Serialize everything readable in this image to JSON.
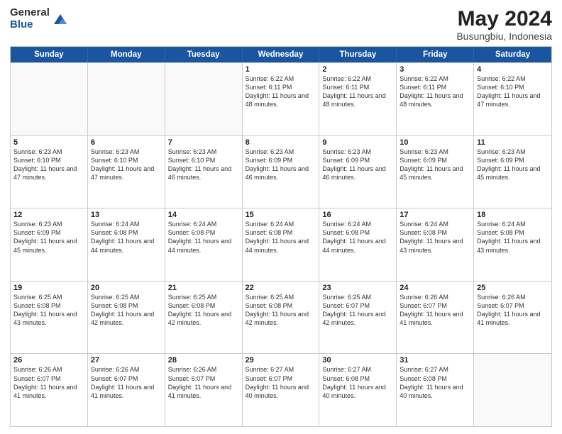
{
  "logo": {
    "general": "General",
    "blue": "Blue"
  },
  "title": "May 2024",
  "location": "Busungbiu, Indonesia",
  "days_of_week": [
    "Sunday",
    "Monday",
    "Tuesday",
    "Wednesday",
    "Thursday",
    "Friday",
    "Saturday"
  ],
  "weeks": [
    [
      {
        "day": "",
        "sunrise": "",
        "sunset": "",
        "daylight": "",
        "empty": true
      },
      {
        "day": "",
        "sunrise": "",
        "sunset": "",
        "daylight": "",
        "empty": true
      },
      {
        "day": "",
        "sunrise": "",
        "sunset": "",
        "daylight": "",
        "empty": true
      },
      {
        "day": "1",
        "sunrise": "Sunrise: 6:22 AM",
        "sunset": "Sunset: 6:11 PM",
        "daylight": "Daylight: 11 hours and 48 minutes.",
        "empty": false
      },
      {
        "day": "2",
        "sunrise": "Sunrise: 6:22 AM",
        "sunset": "Sunset: 6:11 PM",
        "daylight": "Daylight: 11 hours and 48 minutes.",
        "empty": false
      },
      {
        "day": "3",
        "sunrise": "Sunrise: 6:22 AM",
        "sunset": "Sunset: 6:11 PM",
        "daylight": "Daylight: 11 hours and 48 minutes.",
        "empty": false
      },
      {
        "day": "4",
        "sunrise": "Sunrise: 6:22 AM",
        "sunset": "Sunset: 6:10 PM",
        "daylight": "Daylight: 11 hours and 47 minutes.",
        "empty": false
      }
    ],
    [
      {
        "day": "5",
        "sunrise": "Sunrise: 6:23 AM",
        "sunset": "Sunset: 6:10 PM",
        "daylight": "Daylight: 11 hours and 47 minutes.",
        "empty": false
      },
      {
        "day": "6",
        "sunrise": "Sunrise: 6:23 AM",
        "sunset": "Sunset: 6:10 PM",
        "daylight": "Daylight: 11 hours and 47 minutes.",
        "empty": false
      },
      {
        "day": "7",
        "sunrise": "Sunrise: 6:23 AM",
        "sunset": "Sunset: 6:10 PM",
        "daylight": "Daylight: 11 hours and 46 minutes.",
        "empty": false
      },
      {
        "day": "8",
        "sunrise": "Sunrise: 6:23 AM",
        "sunset": "Sunset: 6:09 PM",
        "daylight": "Daylight: 11 hours and 46 minutes.",
        "empty": false
      },
      {
        "day": "9",
        "sunrise": "Sunrise: 6:23 AM",
        "sunset": "Sunset: 6:09 PM",
        "daylight": "Daylight: 11 hours and 46 minutes.",
        "empty": false
      },
      {
        "day": "10",
        "sunrise": "Sunrise: 6:23 AM",
        "sunset": "Sunset: 6:09 PM",
        "daylight": "Daylight: 11 hours and 45 minutes.",
        "empty": false
      },
      {
        "day": "11",
        "sunrise": "Sunrise: 6:23 AM",
        "sunset": "Sunset: 6:09 PM",
        "daylight": "Daylight: 11 hours and 45 minutes.",
        "empty": false
      }
    ],
    [
      {
        "day": "12",
        "sunrise": "Sunrise: 6:23 AM",
        "sunset": "Sunset: 6:09 PM",
        "daylight": "Daylight: 11 hours and 45 minutes.",
        "empty": false
      },
      {
        "day": "13",
        "sunrise": "Sunrise: 6:24 AM",
        "sunset": "Sunset: 6:08 PM",
        "daylight": "Daylight: 11 hours and 44 minutes.",
        "empty": false
      },
      {
        "day": "14",
        "sunrise": "Sunrise: 6:24 AM",
        "sunset": "Sunset: 6:08 PM",
        "daylight": "Daylight: 11 hours and 44 minutes.",
        "empty": false
      },
      {
        "day": "15",
        "sunrise": "Sunrise: 6:24 AM",
        "sunset": "Sunset: 6:08 PM",
        "daylight": "Daylight: 11 hours and 44 minutes.",
        "empty": false
      },
      {
        "day": "16",
        "sunrise": "Sunrise: 6:24 AM",
        "sunset": "Sunset: 6:08 PM",
        "daylight": "Daylight: 11 hours and 44 minutes.",
        "empty": false
      },
      {
        "day": "17",
        "sunrise": "Sunrise: 6:24 AM",
        "sunset": "Sunset: 6:08 PM",
        "daylight": "Daylight: 11 hours and 43 minutes.",
        "empty": false
      },
      {
        "day": "18",
        "sunrise": "Sunrise: 6:24 AM",
        "sunset": "Sunset: 6:08 PM",
        "daylight": "Daylight: 11 hours and 43 minutes.",
        "empty": false
      }
    ],
    [
      {
        "day": "19",
        "sunrise": "Sunrise: 6:25 AM",
        "sunset": "Sunset: 6:08 PM",
        "daylight": "Daylight: 11 hours and 43 minutes.",
        "empty": false
      },
      {
        "day": "20",
        "sunrise": "Sunrise: 6:25 AM",
        "sunset": "Sunset: 6:08 PM",
        "daylight": "Daylight: 11 hours and 42 minutes.",
        "empty": false
      },
      {
        "day": "21",
        "sunrise": "Sunrise: 6:25 AM",
        "sunset": "Sunset: 6:08 PM",
        "daylight": "Daylight: 11 hours and 42 minutes.",
        "empty": false
      },
      {
        "day": "22",
        "sunrise": "Sunrise: 6:25 AM",
        "sunset": "Sunset: 6:08 PM",
        "daylight": "Daylight: 11 hours and 42 minutes.",
        "empty": false
      },
      {
        "day": "23",
        "sunrise": "Sunrise: 6:25 AM",
        "sunset": "Sunset: 6:07 PM",
        "daylight": "Daylight: 11 hours and 42 minutes.",
        "empty": false
      },
      {
        "day": "24",
        "sunrise": "Sunrise: 6:26 AM",
        "sunset": "Sunset: 6:07 PM",
        "daylight": "Daylight: 11 hours and 41 minutes.",
        "empty": false
      },
      {
        "day": "25",
        "sunrise": "Sunrise: 6:26 AM",
        "sunset": "Sunset: 6:07 PM",
        "daylight": "Daylight: 11 hours and 41 minutes.",
        "empty": false
      }
    ],
    [
      {
        "day": "26",
        "sunrise": "Sunrise: 6:26 AM",
        "sunset": "Sunset: 6:07 PM",
        "daylight": "Daylight: 11 hours and 41 minutes.",
        "empty": false
      },
      {
        "day": "27",
        "sunrise": "Sunrise: 6:26 AM",
        "sunset": "Sunset: 6:07 PM",
        "daylight": "Daylight: 11 hours and 41 minutes.",
        "empty": false
      },
      {
        "day": "28",
        "sunrise": "Sunrise: 6:26 AM",
        "sunset": "Sunset: 6:07 PM",
        "daylight": "Daylight: 11 hours and 41 minutes.",
        "empty": false
      },
      {
        "day": "29",
        "sunrise": "Sunrise: 6:27 AM",
        "sunset": "Sunset: 6:07 PM",
        "daylight": "Daylight: 11 hours and 40 minutes.",
        "empty": false
      },
      {
        "day": "30",
        "sunrise": "Sunrise: 6:27 AM",
        "sunset": "Sunset: 6:08 PM",
        "daylight": "Daylight: 11 hours and 40 minutes.",
        "empty": false
      },
      {
        "day": "31",
        "sunrise": "Sunrise: 6:27 AM",
        "sunset": "Sunset: 6:08 PM",
        "daylight": "Daylight: 11 hours and 40 minutes.",
        "empty": false
      },
      {
        "day": "",
        "sunrise": "",
        "sunset": "",
        "daylight": "",
        "empty": true
      }
    ]
  ]
}
